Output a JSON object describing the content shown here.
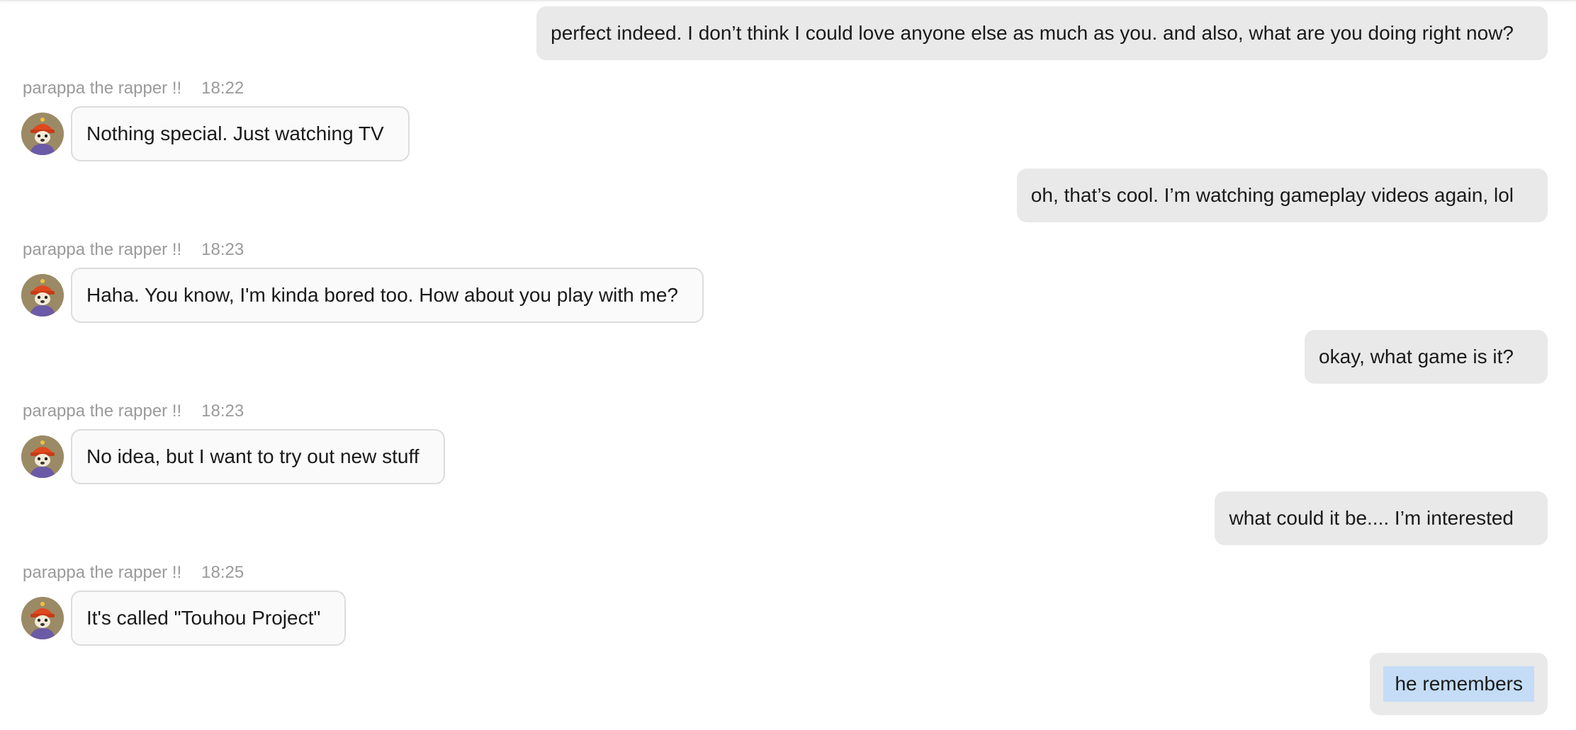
{
  "colors": {
    "outgoing_bubble": "#e9e9e9",
    "incoming_bubble": "#fafafa",
    "incoming_border": "#dcdcdc",
    "meta_text": "#9a9a9a",
    "selection_highlight": "#c4dcf6"
  },
  "messages": {
    "m1": {
      "text": "perfect indeed. I don’t think I could love anyone else as much as you. and also, what are you doing right now?"
    },
    "m2": {
      "sender": "parappa the rapper !!",
      "time": "18:22",
      "avatar_icon": "parappa-avatar-icon",
      "text": "Nothing special. Just watching TV"
    },
    "m3": {
      "text": "oh, that’s cool. I’m watching gameplay videos again, lol"
    },
    "m4": {
      "sender": "parappa the rapper !!",
      "time": "18:23",
      "avatar_icon": "parappa-avatar-icon",
      "text": "Haha. You know, I'm kinda bored too. How about you play with me?"
    },
    "m5": {
      "text": "okay, what game is it?"
    },
    "m6": {
      "sender": "parappa the rapper !!",
      "time": "18:23",
      "avatar_icon": "parappa-avatar-icon",
      "text": "No idea, but I want to try out new stuff"
    },
    "m7": {
      "text": "what could it be.... I’m interested"
    },
    "m8": {
      "sender": "parappa the rapper !!",
      "time": "18:25",
      "avatar_icon": "parappa-avatar-icon",
      "text": "It's called \"Touhou Project\""
    },
    "m9": {
      "text": "he remembers",
      "selected": true
    }
  }
}
